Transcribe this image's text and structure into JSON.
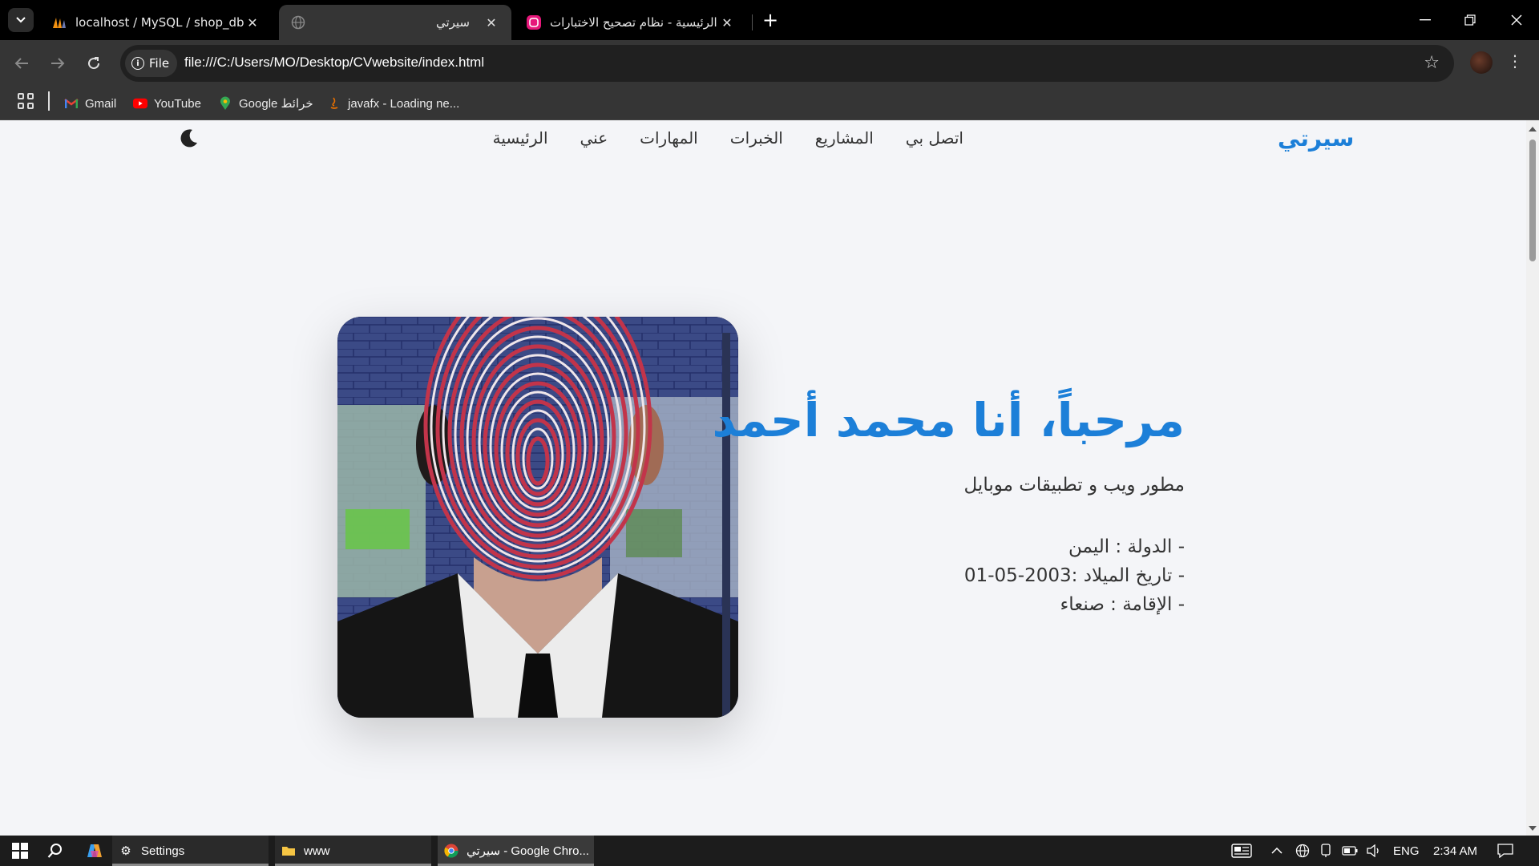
{
  "browser": {
    "tabs": [
      {
        "title": "localhost / MySQL / shop_db / ",
        "favicon": "phpmyadmin-icon",
        "active": false
      },
      {
        "title": "سيرتي",
        "favicon": "globe-icon",
        "active": true
      },
      {
        "title": "الرئيسية - نظام تصحيح الاختبارات",
        "favicon": "app-icon",
        "active": false
      }
    ],
    "address": {
      "chip_label": "File",
      "url": "file:///C:/Users/MO/Desktop/CVwebsite/index.html"
    },
    "bookmarks": [
      {
        "label": "Gmail",
        "icon": "gmail-icon"
      },
      {
        "label": "YouTube",
        "icon": "youtube-icon"
      },
      {
        "label": "Google خرائط",
        "icon": "maps-icon"
      },
      {
        "label": "javafx - Loading ne...",
        "icon": "java-icon"
      }
    ]
  },
  "site": {
    "logo": "سيرتي",
    "nav": [
      "الرئيسية",
      "عني",
      "المهارات",
      "الخبرات",
      "المشاريع",
      "اتصل بي"
    ],
    "theme_toggle_icon": "moon-icon",
    "hero": {
      "title": "مرحباً، أنا محمد أحمد",
      "subtitle": "مطور ويب و تطبيقات موبايل",
      "info": [
        "- الدولة : اليمن",
        "- تاريخ الميلاد :2003-05-01",
        "- الإقامة : صنعاء"
      ]
    },
    "colors": {
      "accent": "#1c7fd8",
      "text": "#333333",
      "background": "#f4f5f8"
    }
  },
  "taskbar": {
    "apps": [
      {
        "label": "Settings",
        "icon": "gear-icon"
      },
      {
        "label": "www",
        "icon": "folder-icon"
      },
      {
        "label": "سيرتي - Google Chro...",
        "icon": "chrome-icon"
      }
    ],
    "tray": {
      "language": "ENG",
      "time": "2:34 AM"
    }
  }
}
